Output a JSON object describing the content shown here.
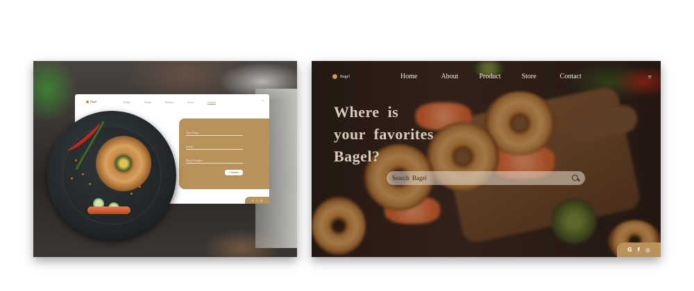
{
  "left_mock": {
    "brand": "Bagel",
    "nav": [
      "Home",
      "About",
      "Product",
      "Store",
      "Contact"
    ],
    "active_nav": "Contact",
    "menu_icon": "close-icon",
    "form": {
      "fields": [
        "Your Name",
        "Email",
        "Phone Number"
      ],
      "submit_label": "Contact"
    },
    "social": [
      "G",
      "f",
      "◎"
    ]
  },
  "right_mock": {
    "brand": "Bagel",
    "nav": [
      "Home",
      "About",
      "Product",
      "Store",
      "Contact"
    ],
    "menu_icon": "hamburger-icon",
    "menu_glyph": "≡",
    "hero_lines": [
      "Where  is",
      "your  favorites",
      "Bagel?"
    ],
    "search": {
      "placeholder": "Search  Bagel",
      "icon": "search-icon"
    },
    "social": [
      "G",
      "f",
      "◎"
    ]
  },
  "colors": {
    "accent": "#b8925a",
    "hero_text": "#d8cbbb",
    "nav_text": "#f3ede4"
  }
}
